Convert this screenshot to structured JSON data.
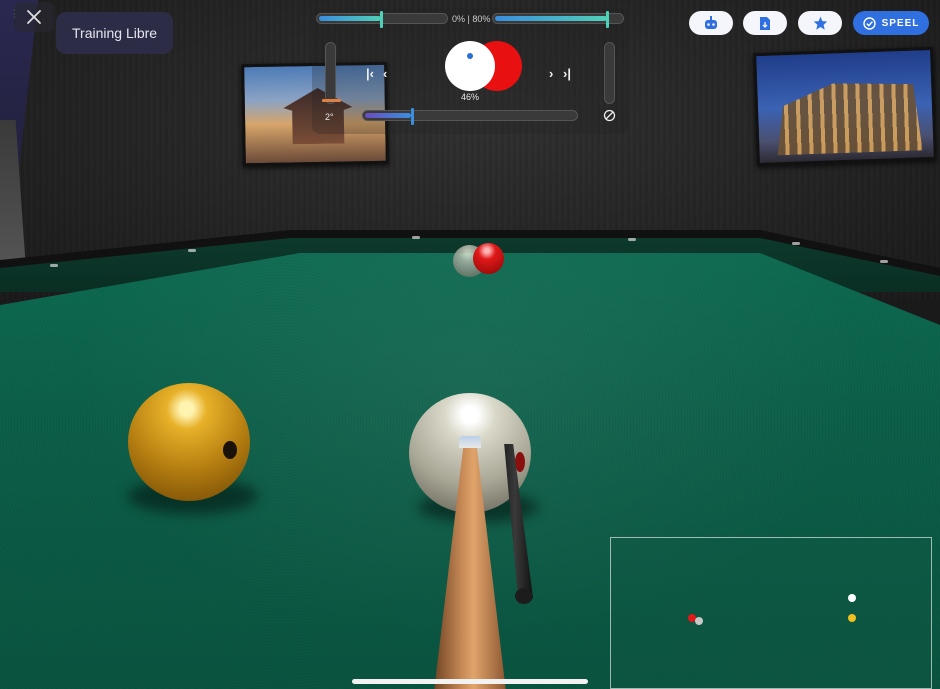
{
  "mode": {
    "title": "Training Libre"
  },
  "controls": {
    "power_readout": "0% | 80%",
    "spin_percent": "46%",
    "elevation": "2°",
    "power_min_pct": 50,
    "power_max_pct": 80
  },
  "toolbar": {
    "speel_label": "SPEEL"
  },
  "colors": {
    "felt": "#0c5f49",
    "accent_blue": "#2f6fe0",
    "object_ball_red": "#e01919",
    "cue_ball_yellow": "#e7b129",
    "cue_ball_white": "#ffffff"
  },
  "icons": {
    "close": "close-icon",
    "robot": "robot-icon",
    "document": "document-download-icon",
    "star": "star-icon",
    "check": "check-circle-icon",
    "no_entry": "no-symbol-icon"
  }
}
